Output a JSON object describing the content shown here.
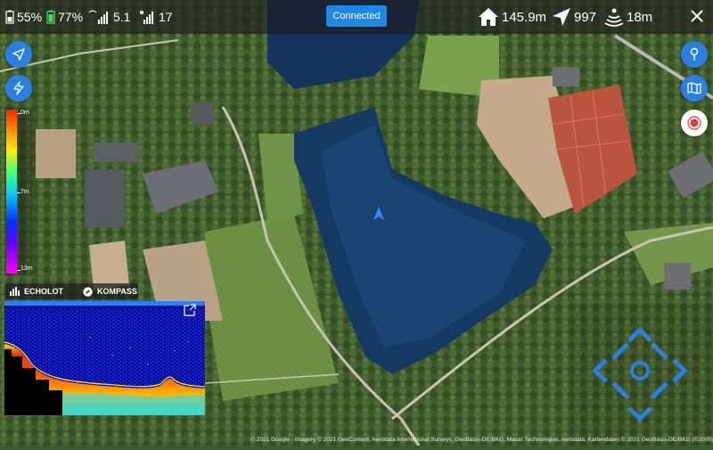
{
  "statusbar": {
    "battery_1": "55%",
    "battery_2": "77%",
    "signal_1": "5.1",
    "signal_2": "17",
    "connection_label": "Connected",
    "distance": "145.9m",
    "speed_value": "997",
    "depth": "18m",
    "icons": [
      "phone-battery-icon",
      "boat-battery-icon",
      "wifi-signal-icon",
      "gps-signal-icon",
      "home-icon",
      "navigation-arrow-icon",
      "sonar-waves-icon",
      "close-icon"
    ]
  },
  "left_buttons": [
    "location-arrow-icon",
    "lightning-icon"
  ],
  "right_buttons": [
    "map-pin-icon",
    "map-layers-icon",
    "record-icon"
  ],
  "depth_scale": {
    "top": "0m",
    "middle": "7m",
    "bottom": "13m"
  },
  "modes": {
    "echolot": "ECHOLOT",
    "kompass": "KOMPASS"
  },
  "attribution": "© 2021 Google · Imagery © 2021 GeoContent, Aerodata International Surveys, GeoBasis-DE/BKG, Maxar Technologies, Aerodata, Kartendaten © 2021 GeoBasis-DE/BKG (©2009)",
  "colors": {
    "accent": "#2a7fe0",
    "record": "#e53935",
    "connected": "#1e88e5"
  }
}
